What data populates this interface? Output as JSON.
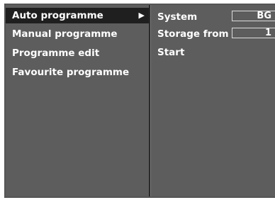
{
  "menu": {
    "items": [
      {
        "label": "Auto programme",
        "selected": true,
        "arrow": "▶"
      },
      {
        "label": "Manual programme",
        "selected": false
      },
      {
        "label": "Programme edit",
        "selected": false
      },
      {
        "label": "Favourite programme",
        "selected": false
      }
    ]
  },
  "submenu": {
    "system_label": "System",
    "system_value": "BG",
    "storage_label": "Storage from",
    "storage_value": "1",
    "start_label": "Start"
  },
  "colors": {
    "panel_bg": "#5d5d5d",
    "selected_bg": "#1f1f1f",
    "text": "#ffffff"
  }
}
